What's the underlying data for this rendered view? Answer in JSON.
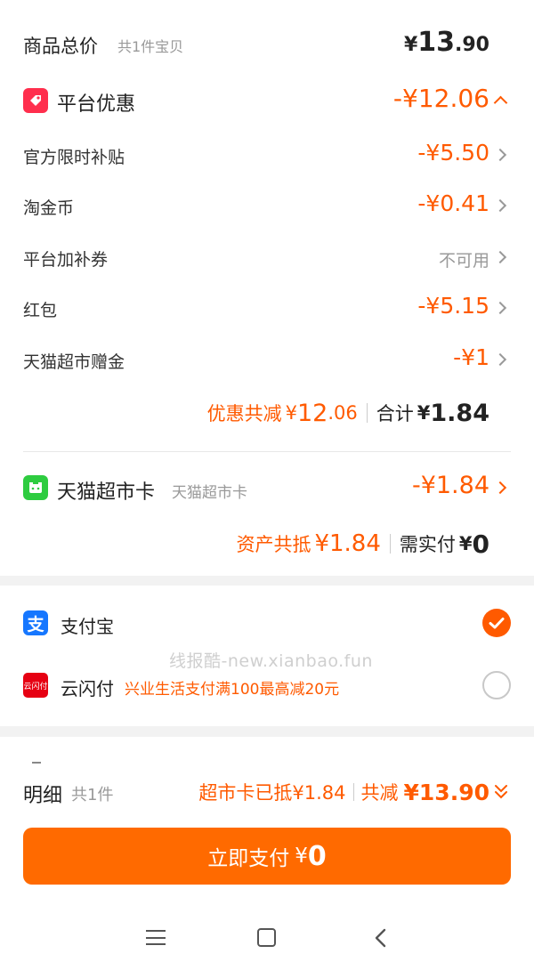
{
  "summary": {
    "title": "商品总价",
    "count": "共1件宝贝",
    "currency": "¥",
    "price_int": "13",
    "price_dec": ".90"
  },
  "platform": {
    "label": "平台优惠",
    "amount": "-¥12.06",
    "items": [
      {
        "label": "官方限时补贴",
        "value": "-¥5.50"
      },
      {
        "label": "淘金币",
        "value": "-¥0.41"
      },
      {
        "label": "平台加补券",
        "value": "不可用"
      },
      {
        "label": "红包",
        "value": "-¥5.15"
      },
      {
        "label": "天猫超市赠金",
        "value": "-¥1"
      }
    ],
    "total_label": "优惠共减",
    "total_currency": "¥",
    "total_int": "12",
    "total_dec": ".06",
    "sum_label": "合计",
    "sum_currency": "¥",
    "sum_value": "1.84"
  },
  "card": {
    "label": "天猫超市卡",
    "sub": "天猫超市卡",
    "amount": "-¥1.84",
    "asset_label": "资产共抵",
    "asset_value": "¥1.84",
    "pay_label": "需实付",
    "pay_currency": "¥",
    "pay_value": "0"
  },
  "payment": {
    "alipay_label": "支付宝",
    "unionpay_label": "云闪付",
    "unionpay_promo": "兴业生活支付满100最高减20元",
    "watermark": "线报酷-new.xianbao.fun"
  },
  "detail": {
    "label": "明细",
    "count": "共1件",
    "card_deduct": "超市卡已抵¥1.84",
    "total_label": "共减",
    "total_value": "¥13.90"
  },
  "button": {
    "label": "立即支付",
    "currency": "¥",
    "value": "0"
  },
  "colors": {
    "accent": "#ff5a00",
    "button": "#ff6a00",
    "alipay": "#1677ff",
    "tmall_card": "#2ecc40"
  }
}
